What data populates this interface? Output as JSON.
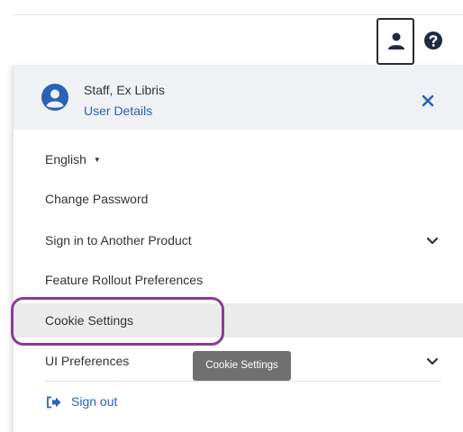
{
  "user": {
    "name": "Staff, Ex Libris",
    "details_link": "User Details"
  },
  "menu": {
    "language": "English",
    "language_caret": "▼",
    "change_password": "Change Password",
    "sign_in_another": "Sign in to Another Product",
    "feature_rollout": "Feature Rollout Preferences",
    "cookie_settings": "Cookie Settings",
    "ui_preferences": "UI Preferences",
    "sign_out": "Sign out"
  },
  "tooltip": {
    "text": "Cookie Settings"
  },
  "colors": {
    "accent_blue": "#2a62b8",
    "highlight_ring": "#8a3c96",
    "header_bg": "#f0f1f5",
    "tooltip_bg": "#707070"
  },
  "icons": {
    "user_button": "user-icon",
    "help": "help-circle-icon",
    "avatar": "account-circle-icon",
    "close": "close-icon",
    "chevron": "chevron-down-icon",
    "sign_out": "sign-out-icon"
  }
}
